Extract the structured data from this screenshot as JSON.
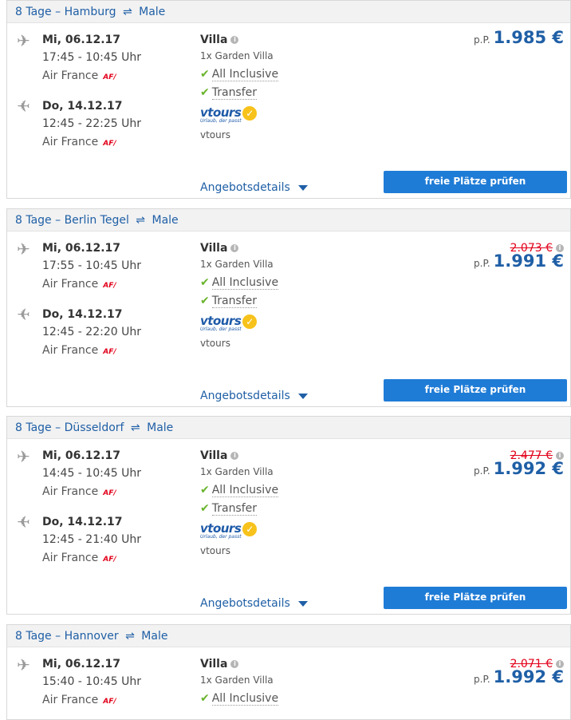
{
  "offers": [
    {
      "duration": "8 Tage",
      "origin": "Hamburg",
      "destination": "Male",
      "outbound": {
        "date": "Mi, 06.12.17",
        "time": "17:45 - 10:45 Uhr",
        "airline": "Air France"
      },
      "inbound": {
        "date": "Do, 14.12.17",
        "time": "12:45 - 22:25 Uhr",
        "airline": "Air France"
      },
      "hotel": {
        "name": "Villa",
        "room": "1x Garden Villa",
        "board": "All Inclusive",
        "transfer": "Transfer",
        "operator": "vtours"
      },
      "old_price": "",
      "pp": "p.P.",
      "price": "1.985 €",
      "details": "Angebotsdetails",
      "cta": "freie Plätze prüfen"
    },
    {
      "duration": "8 Tage",
      "origin": "Berlin Tegel",
      "destination": "Male",
      "outbound": {
        "date": "Mi, 06.12.17",
        "time": "17:55 - 10:45 Uhr",
        "airline": "Air France"
      },
      "inbound": {
        "date": "Do, 14.12.17",
        "time": "12:45 - 22:20 Uhr",
        "airline": "Air France"
      },
      "hotel": {
        "name": "Villa",
        "room": "1x Garden Villa",
        "board": "All Inclusive",
        "transfer": "Transfer",
        "operator": "vtours"
      },
      "old_price": "2.073 €",
      "pp": "p.P.",
      "price": "1.991 €",
      "details": "Angebotsdetails",
      "cta": "freie Plätze prüfen"
    },
    {
      "duration": "8 Tage",
      "origin": "Düsseldorf",
      "destination": "Male",
      "outbound": {
        "date": "Mi, 06.12.17",
        "time": "14:45 - 10:45 Uhr",
        "airline": "Air France"
      },
      "inbound": {
        "date": "Do, 14.12.17",
        "time": "12:45 - 21:40 Uhr",
        "airline": "Air France"
      },
      "hotel": {
        "name": "Villa",
        "room": "1x Garden Villa",
        "board": "All Inclusive",
        "transfer": "Transfer",
        "operator": "vtours"
      },
      "old_price": "2.477 €",
      "pp": "p.P.",
      "price": "1.992 €",
      "details": "Angebotsdetails",
      "cta": "freie Plätze prüfen"
    },
    {
      "duration": "8 Tage",
      "origin": "Hannover",
      "destination": "Male",
      "outbound": {
        "date": "Mi, 06.12.17",
        "time": "15:40 - 10:45 Uhr",
        "airline": "Air France"
      },
      "hotel": {
        "name": "Villa",
        "room": "1x Garden Villa",
        "board": "All Inclusive"
      },
      "old_price": "2.071 €",
      "pp": "p.P.",
      "price": "1.992 €"
    }
  ],
  "brand": {
    "accent": "#1f5fa6",
    "button": "#1f7cd6",
    "strike": "#e2001a",
    "check": "#6ab42d"
  },
  "logo_text": {
    "vtours": "vtours",
    "tagline": "Urlaub, der passt"
  },
  "airline_logo": {
    "left": "AF",
    "right": "/"
  },
  "icons": {
    "outbound": "plane-departure-icon",
    "inbound": "plane-return-icon",
    "info": "info-icon",
    "check": "check-icon",
    "caret": "caret-down-icon",
    "swap": "swap-arrows-icon"
  }
}
